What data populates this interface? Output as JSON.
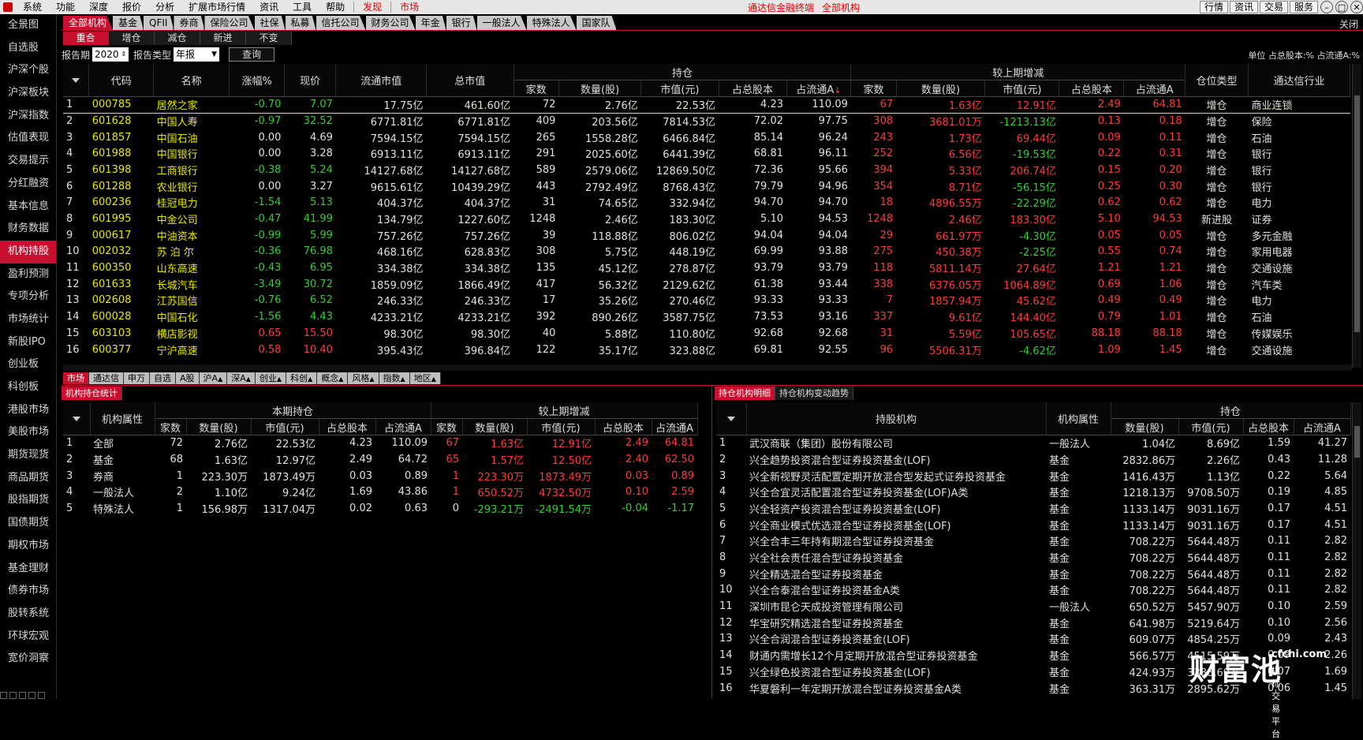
{
  "menu": {
    "items": [
      "系统",
      "功能",
      "深度",
      "报价",
      "分析",
      "扩展市场行情",
      "资讯",
      "工具",
      "帮助"
    ],
    "discover": "发现",
    "market": "市场",
    "center": [
      "通达信金融终端",
      "全部机构"
    ],
    "right_buttons": [
      "行情",
      "资讯",
      "交易",
      "服务"
    ],
    "win": [
      "–",
      "□",
      "✕"
    ]
  },
  "sidebar": [
    "全景图",
    "自选股",
    "沪深个股",
    "沪深板块",
    "沪深指数",
    "估值表现",
    "交易提示",
    "分红融资",
    "基本信息",
    "财务数据",
    "机构持股",
    "盈利预测",
    "专项分析",
    "市场统计",
    "新股IPO",
    "创业板",
    "科创板",
    "港股市场",
    "美股市场",
    "期货现货",
    "商品期货",
    "股指期货",
    "国债期货",
    "期权市场",
    "基金理财",
    "债券市场",
    "股转系统",
    "环球宏观",
    "宽价洞察"
  ],
  "top_tabs": [
    "全部机构",
    "基金",
    "QFII",
    "券商",
    "保险公司",
    "社保",
    "私募",
    "信托公司",
    "财务公司",
    "年金",
    "银行",
    "一般法人",
    "特殊法人",
    "国家队"
  ],
  "close_label": "关闭",
  "sub_tabs": [
    "重合",
    "增仓",
    "减仓",
    "新进",
    "不变"
  ],
  "filter": {
    "period_label": "报告期",
    "period_value": "2020",
    "type_label": "报告类型",
    "type_value": "年报",
    "query_label": "查询"
  },
  "unit_text": "单位 占总股本:% 占流通A:%",
  "main_table": {
    "group_hold": "持仓",
    "group_change": "较上期增减",
    "headers": [
      "代码",
      "名称",
      "涨幅%",
      "现价",
      "流通市值",
      "总市值",
      "家数",
      "数量(股)",
      "市值(元)",
      "占总股本",
      "占流通A",
      "家数",
      "数量(股)",
      "市值(元)",
      "占总股本",
      "占流通A",
      "仓位类型",
      "通达信行业"
    ],
    "rows": [
      [
        "1",
        "000785",
        "居然之家",
        "-0.70",
        "7.07",
        "17.75亿",
        "461.60亿",
        "72",
        "2.76亿",
        "22.53亿",
        "4.23",
        "110.09",
        "67",
        "1.63亿",
        "12.91亿",
        "2.49",
        "64.81",
        "增仓",
        "商业连锁"
      ],
      [
        "2",
        "601628",
        "中国人寿",
        "-0.97",
        "32.52",
        "6771.81亿",
        "6771.81亿",
        "409",
        "203.56亿",
        "7814.53亿",
        "72.02",
        "97.75",
        "308",
        "3681.01万",
        "-1213.13亿",
        "0.13",
        "0.18",
        "增仓",
        "保险"
      ],
      [
        "3",
        "601857",
        "中国石油",
        "0.00",
        "4.69",
        "7594.15亿",
        "7594.15亿",
        "265",
        "1558.28亿",
        "6466.84亿",
        "85.14",
        "96.24",
        "243",
        "1.73亿",
        "69.44亿",
        "0.09",
        "0.11",
        "增仓",
        "石油"
      ],
      [
        "4",
        "601988",
        "中国银行",
        "0.00",
        "3.28",
        "6913.11亿",
        "6913.11亿",
        "291",
        "2025.60亿",
        "6441.39亿",
        "68.81",
        "96.11",
        "252",
        "6.56亿",
        "-19.53亿",
        "0.22",
        "0.31",
        "增仓",
        "银行"
      ],
      [
        "5",
        "601398",
        "工商银行",
        "-0.38",
        "5.24",
        "14127.68亿",
        "14127.68亿",
        "589",
        "2579.06亿",
        "12869.50亿",
        "72.36",
        "95.66",
        "394",
        "5.33亿",
        "206.74亿",
        "0.15",
        "0.20",
        "增仓",
        "银行"
      ],
      [
        "6",
        "601288",
        "农业银行",
        "0.00",
        "3.27",
        "9615.61亿",
        "10439.29亿",
        "443",
        "2792.49亿",
        "8768.43亿",
        "79.79",
        "94.96",
        "354",
        "8.71亿",
        "-56.15亿",
        "0.25",
        "0.30",
        "增仓",
        "银行"
      ],
      [
        "7",
        "600236",
        "桂冠电力",
        "-1.54",
        "5.13",
        "404.37亿",
        "404.37亿",
        "31",
        "74.65亿",
        "332.94亿",
        "94.70",
        "94.70",
        "18",
        "4896.55万",
        "-22.29亿",
        "0.62",
        "0.62",
        "增仓",
        "电力"
      ],
      [
        "8",
        "601995",
        "中金公司",
        "-0.47",
        "41.99",
        "134.79亿",
        "1227.60亿",
        "1248",
        "2.46亿",
        "183.30亿",
        "5.10",
        "94.53",
        "1248",
        "2.46亿",
        "183.30亿",
        "5.10",
        "94.53",
        "新进股",
        "证券"
      ],
      [
        "9",
        "000617",
        "中油资本",
        "-0.99",
        "5.99",
        "757.26亿",
        "757.26亿",
        "39",
        "118.88亿",
        "806.02亿",
        "94.04",
        "94.04",
        "29",
        "661.97万",
        "-4.30亿",
        "0.05",
        "0.05",
        "增仓",
        "多元金融"
      ],
      [
        "10",
        "002032",
        "苏 泊 尔",
        "-0.36",
        "76.98",
        "468.16亿",
        "628.83亿",
        "308",
        "5.75亿",
        "448.19亿",
        "69.99",
        "93.88",
        "275",
        "450.38万",
        "-2.25亿",
        "0.55",
        "0.74",
        "增仓",
        "家用电器"
      ],
      [
        "11",
        "600350",
        "山东高速",
        "-0.43",
        "6.95",
        "334.38亿",
        "334.38亿",
        "135",
        "45.12亿",
        "278.87亿",
        "93.79",
        "93.79",
        "118",
        "5811.14万",
        "27.64亿",
        "1.21",
        "1.21",
        "增仓",
        "交通设施"
      ],
      [
        "12",
        "601633",
        "长城汽车",
        "-3.49",
        "30.72",
        "1859.09亿",
        "1866.49亿",
        "417",
        "56.32亿",
        "2129.62亿",
        "61.38",
        "93.44",
        "338",
        "6376.05万",
        "1064.89亿",
        "0.69",
        "1.06",
        "增仓",
        "汽车类"
      ],
      [
        "13",
        "002608",
        "江苏国信",
        "-0.76",
        "6.52",
        "246.33亿",
        "246.33亿",
        "17",
        "35.26亿",
        "270.46亿",
        "93.33",
        "93.33",
        "7",
        "1857.94万",
        "45.62亿",
        "0.49",
        "0.49",
        "增仓",
        "电力"
      ],
      [
        "14",
        "600028",
        "中国石化",
        "-1.56",
        "4.43",
        "4233.21亿",
        "4233.21亿",
        "392",
        "890.26亿",
        "3587.75亿",
        "73.53",
        "93.16",
        "337",
        "9.61亿",
        "144.40亿",
        "0.79",
        "1.01",
        "增仓",
        "石油"
      ],
      [
        "15",
        "603103",
        "横店影视",
        "0.65",
        "15.50",
        "98.30亿",
        "98.30亿",
        "40",
        "5.88亿",
        "110.80亿",
        "92.68",
        "92.68",
        "31",
        "5.59亿",
        "105.65亿",
        "88.18",
        "88.18",
        "增仓",
        "传媒娱乐"
      ],
      [
        "16",
        "600377",
        "宁沪高速",
        "0.58",
        "10.40",
        "395.43亿",
        "396.84亿",
        "122",
        "35.17亿",
        "323.88亿",
        "69.81",
        "92.55",
        "96",
        "5506.31万",
        "-4.62亿",
        "1.09",
        "1.45",
        "增仓",
        "交通设施"
      ]
    ]
  },
  "bottom_tabs": [
    "市场",
    "通达信",
    "申万",
    "自选",
    "A股",
    "沪A",
    "深A",
    "创业",
    "科创",
    "概念",
    "风格",
    "指数",
    "地区"
  ],
  "left_section": {
    "tab": "机构持仓统计",
    "group_now": "本期持仓",
    "group_change": "较上期增减",
    "headers": [
      "机构属性",
      "家数",
      "数量(股)",
      "市值(元)",
      "占总股本",
      "占流通A",
      "家数",
      "数量(股)",
      "市值(元)",
      "占总股本",
      "占流通A"
    ],
    "rows": [
      [
        "1",
        "全部",
        "72",
        "2.76亿",
        "22.53亿",
        "4.23",
        "110.09",
        "67",
        "1.63亿",
        "12.91亿",
        "2.49",
        "64.81"
      ],
      [
        "2",
        "基金",
        "68",
        "1.63亿",
        "12.97亿",
        "2.49",
        "64.72",
        "65",
        "1.57亿",
        "12.50亿",
        "2.40",
        "62.50"
      ],
      [
        "3",
        "券商",
        "1",
        "223.30万",
        "1873.49万",
        "0.03",
        "0.89",
        "1",
        "223.30万",
        "1873.49万",
        "0.03",
        "0.89"
      ],
      [
        "4",
        "一般法人",
        "2",
        "1.10亿",
        "9.24亿",
        "1.69",
        "43.86",
        "1",
        "650.52万",
        "4732.50万",
        "0.10",
        "2.59"
      ],
      [
        "5",
        "特殊法人",
        "1",
        "156.98万",
        "1317.04万",
        "0.02",
        "0.63",
        "0",
        "-293.21万",
        "-2491.54万",
        "-0.04",
        "-1.17"
      ]
    ]
  },
  "right_section": {
    "tabs": [
      "持仓机构明细",
      "持仓机构变动趋势"
    ],
    "group_hold": "持仓",
    "headers": [
      "持股机构",
      "机构属性",
      "数量(股)",
      "市值(元)",
      "占总股本",
      "占流通A"
    ],
    "rows": [
      [
        "1",
        "武汉商联（集团）股份有限公司",
        "一般法人",
        "1.04亿",
        "8.69亿",
        "1.59",
        "41.27"
      ],
      [
        "2",
        "兴全趋势投资混合型证券投资基金(LOF)",
        "基金",
        "2832.86万",
        "2.26亿",
        "0.43",
        "11.28"
      ],
      [
        "3",
        "兴全新视野灵活配置定期开放混合型发起式证券投资基金",
        "基金",
        "1416.43万",
        "1.13亿",
        "0.22",
        "5.64"
      ],
      [
        "4",
        "兴全合宜灵活配置混合型证券投资基金(LOF)A类",
        "基金",
        "1218.13万",
        "9708.50万",
        "0.19",
        "4.85"
      ],
      [
        "5",
        "兴全轻资产投资混合型证券投资基金(LOF)",
        "基金",
        "1133.14万",
        "9031.16万",
        "0.17",
        "4.51"
      ],
      [
        "6",
        "兴全商业模式优选混合型证券投资基金(LOF)",
        "基金",
        "1133.14万",
        "9031.16万",
        "0.17",
        "4.51"
      ],
      [
        "7",
        "兴全合丰三年持有期混合型证券投资基金",
        "基金",
        "708.22万",
        "5644.48万",
        "0.11",
        "2.82"
      ],
      [
        "8",
        "兴全社会责任混合型证券投资基金",
        "基金",
        "708.22万",
        "5644.48万",
        "0.11",
        "2.82"
      ],
      [
        "9",
        "兴全精选混合型证券投资基金",
        "基金",
        "708.22万",
        "5644.48万",
        "0.11",
        "2.82"
      ],
      [
        "10",
        "兴全合泰混合型证券投资基金A类",
        "基金",
        "708.22万",
        "5644.48万",
        "0.11",
        "2.82"
      ],
      [
        "11",
        "深圳市昆仑天成投资管理有限公司",
        "一般法人",
        "650.52万",
        "5457.90万",
        "0.10",
        "2.59"
      ],
      [
        "12",
        "华宝研究精选混合型证券投资基金",
        "基金",
        "641.98万",
        "5219.64万",
        "0.10",
        "2.56"
      ],
      [
        "13",
        "兴全合润混合型证券投资基金(LOF)",
        "基金",
        "609.07万",
        "4854.25万",
        "0.09",
        "2.43"
      ],
      [
        "14",
        "财通内需增长12个月定期开放混合型证券投资基金",
        "基金",
        "566.57万",
        "4515.59万",
        "0.09",
        "2.26"
      ],
      [
        "15",
        "兴全绿色投资混合型证券投资基金(LOF)",
        "基金",
        "424.93万",
        "3386.69万",
        "0.07",
        "1.69"
      ],
      [
        "16",
        "华夏磐利一年定期开放混合型证券投资基金A类",
        "基金",
        "363.31万",
        "2895.62万",
        "0.06",
        "1.45"
      ]
    ]
  },
  "watermark": {
    "big": "财富池",
    "site": "cfchi.com",
    "sub": "指标交易平台"
  },
  "colors": {
    "up": "#ff3b3b",
    "down": "#30d030",
    "code": "#e8e800",
    "accent": "#c8102e"
  }
}
